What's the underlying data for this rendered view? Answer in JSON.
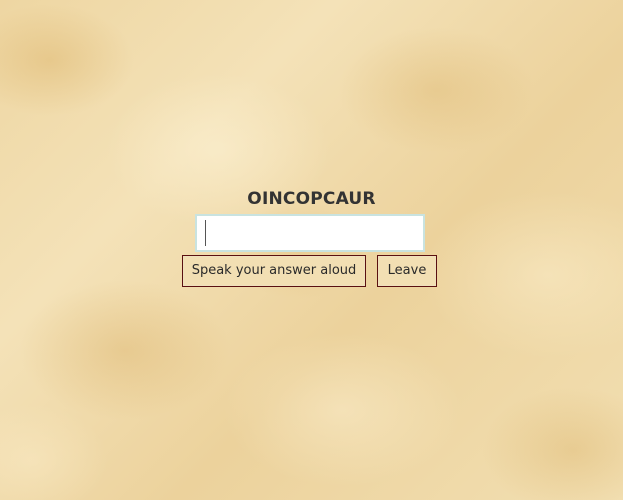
{
  "game": {
    "scrambled_word": "OINCOPCAUR",
    "answer_value": "",
    "speak_button_label": "Speak your answer aloud",
    "leave_button_label": "Leave"
  },
  "colors": {
    "parchment_base": "#f0dcae",
    "button_border": "#5a1010",
    "input_border": "#c9e3e0",
    "word_color": "#333333"
  }
}
